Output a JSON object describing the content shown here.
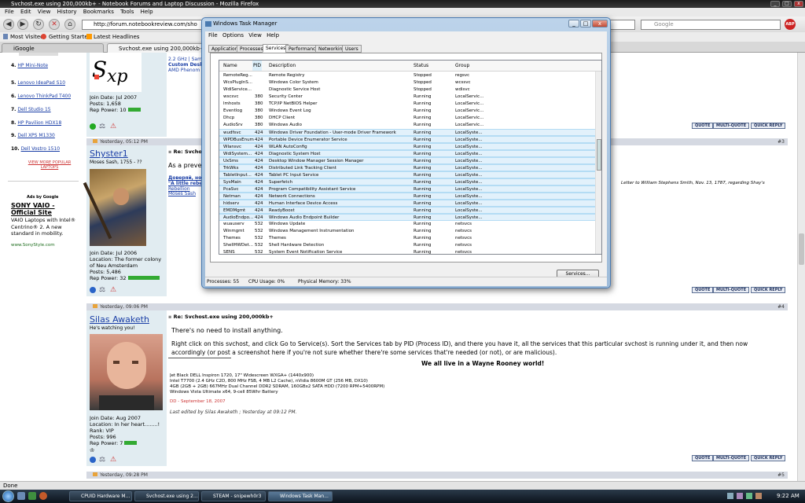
{
  "firefox": {
    "title": "Svchost.exe using 200,000kb+ - Notebook Forums and Laptop Discussion - Mozilla Firefox",
    "menu": [
      "File",
      "Edit",
      "View",
      "History",
      "Bookmarks",
      "Tools",
      "Help"
    ],
    "url": "http://forum.notebookreview.com/sho",
    "search_placeholder": "Google",
    "bookmarks": [
      "Most Visited",
      "Getting Started",
      "Latest Headlines"
    ],
    "tabs": [
      "iGoogle",
      "Svchost.exe using 200,000kb+ -..."
    ],
    "status": "Done"
  },
  "sidebar": {
    "items": [
      {
        "num": "4.",
        "label": "HP Mini-Note"
      },
      {
        "num": "5.",
        "label": "Lenovo IdeaPad S10"
      },
      {
        "num": "6.",
        "label": "Lenovo ThinkPad T400"
      },
      {
        "num": "7.",
        "label": "Dell Studio 15"
      },
      {
        "num": "8.",
        "label": "HP Pavilion HDX18"
      },
      {
        "num": "9.",
        "label": "Dell XPS M1330"
      },
      {
        "num": "10.",
        "label": "Dell Vostro 1510"
      }
    ],
    "view_more": "VIEW MORE POPULAR LAPTOPS",
    "ads_by": "Ads by Google",
    "ad_title": "SONY VAIO - Official Site",
    "ad_body": "VAIO Laptops with Intel® Centrino® 2. A new standard in mobility.",
    "ad_url": "www.SonyStyle.com"
  },
  "post_top": {
    "join": "Join Date: Jul 2007",
    "posts": "Posts: 1,658",
    "rep": "Rep Power: 10",
    "sig1": "2.2 GHz | Sam",
    "sig2": "Custom Deskt",
    "sig3": "AMD Phenom"
  },
  "post3": {
    "date": "Yesterday, 05:12 PM",
    "num": "#3",
    "user": "Shyster1",
    "subtitle": "Moses Sash, 1755 - ??",
    "title": "Re: Svchost",
    "text": "As a preven",
    "quote_tail": "Letter to William Stephens Smith, Nov. 13, 1787, regarding Shay's",
    "sig_a": "Доверяй, но п",
    "sig_b": "\"A little rebell",
    "sig_c": "Rebellion",
    "sig_d": "Moses Sash",
    "join": "Join Date: Jul 2006",
    "location": "Location: The former colony of Neu Amsterdam",
    "posts": "Posts: 5,486",
    "rep": "Rep Power: 32"
  },
  "post4": {
    "date": "Yesterday, 09:06 PM",
    "num": "#4",
    "user": "Silas Awaketh",
    "subtitle": "He's watching you!",
    "title": "Re: Svchost.exe using 200,000kb+",
    "line1": "There's no need to install anything.",
    "line2": "Right click on this svchost, and click Go to Service(s). Sort the Services tab by PID (Process ID), and there you have it, all the services that this particular svchost is running under it, and then now accordingly (or post a screenshot here if you're not sure whether there're some services that're needed (or not), or are malicious).",
    "sig_line": "We all live in a Wayne Rooney world!",
    "spec1": "Jet Black DELL Inspiron 1720, 17\" Widescreen WXGA+ (1440x900)",
    "spec2": "Intel T7700 (2.4 GHz C2D, 800 MHz FSB, 4 MB L2 Cache), nVidia 8600M GT (256 MB, DX10)",
    "spec3": "4GB (2GB + 2GB) 667MHz Dual Channel DDR2 SDRAM, 160GBx2 SATA HDD (7200 RPM+5400RPM)",
    "spec4": "Windows Vista Ultimate x64, 9-cell 85Whr Battery",
    "dd": "DD - September 18, 2007",
    "edited": "Last edited by Silas Awaketh ; Yesterday at 09:12 PM.",
    "join": "Join Date: Aug 2007",
    "location": "Location: In her heart........!",
    "rank": "Rank: VIP",
    "posts": "Posts: 996",
    "rep": "Rep Power: 7"
  },
  "post5": {
    "date": "Yesterday, 09:28 PM",
    "num": "#5"
  },
  "post_buttons": [
    "QUOTE",
    "MULTI-QUOTE",
    "QUICK REPLY"
  ],
  "task_manager": {
    "title": "Windows Task Manager",
    "menu": [
      "File",
      "Options",
      "View",
      "Help"
    ],
    "tabs": [
      "Applications",
      "Processes",
      "Services",
      "Performance",
      "Networking",
      "Users"
    ],
    "active_tab": "Services",
    "columns": [
      "Name",
      "PID",
      "Description",
      "Status",
      "Group"
    ],
    "rows": [
      {
        "name": "RemoteReg...",
        "pid": "",
        "desc": "Remote Registry",
        "status": "Stopped",
        "group": "regsvc",
        "sel": false
      },
      {
        "name": "WcsPlugInS...",
        "pid": "",
        "desc": "Windows Color System",
        "status": "Stopped",
        "group": "wcssvc",
        "sel": false
      },
      {
        "name": "WdiService...",
        "pid": "",
        "desc": "Diagnostic Service Host",
        "status": "Stopped",
        "group": "wdisvc",
        "sel": false
      },
      {
        "name": "wscsvc",
        "pid": "380",
        "desc": "Security Center",
        "status": "Running",
        "group": "LocalServic...",
        "sel": false
      },
      {
        "name": "lmhosts",
        "pid": "380",
        "desc": "TCP/IP NetBIOS Helper",
        "status": "Running",
        "group": "LocalServic...",
        "sel": false
      },
      {
        "name": "Eventlog",
        "pid": "380",
        "desc": "Windows Event Log",
        "status": "Running",
        "group": "LocalServic...",
        "sel": false
      },
      {
        "name": "Dhcp",
        "pid": "380",
        "desc": "DHCP Client",
        "status": "Running",
        "group": "LocalServic...",
        "sel": false
      },
      {
        "name": "AudioSrv",
        "pid": "380",
        "desc": "Windows Audio",
        "status": "Running",
        "group": "LocalServic...",
        "sel": false
      },
      {
        "name": "wudfsvc",
        "pid": "424",
        "desc": "Windows Driver Foundation - User-mode Driver Framework",
        "status": "Running",
        "group": "LocalSyste...",
        "sel": true
      },
      {
        "name": "WPDBusEnum",
        "pid": "424",
        "desc": "Portable Device Enumerator Service",
        "status": "Running",
        "group": "LocalSyste...",
        "sel": true
      },
      {
        "name": "Wlansvc",
        "pid": "424",
        "desc": "WLAN AutoConfig",
        "status": "Running",
        "group": "LocalSyste...",
        "sel": true
      },
      {
        "name": "WdiSystem...",
        "pid": "424",
        "desc": "Diagnostic System Host",
        "status": "Running",
        "group": "LocalSyste...",
        "sel": true
      },
      {
        "name": "UxSms",
        "pid": "424",
        "desc": "Desktop Window Manager Session Manager",
        "status": "Running",
        "group": "LocalSyste...",
        "sel": true
      },
      {
        "name": "TrkWks",
        "pid": "424",
        "desc": "Distributed Link Tracking Client",
        "status": "Running",
        "group": "LocalSyste...",
        "sel": true
      },
      {
        "name": "TabletInput...",
        "pid": "424",
        "desc": "Tablet PC Input Service",
        "status": "Running",
        "group": "LocalSyste...",
        "sel": true
      },
      {
        "name": "SysMain",
        "pid": "424",
        "desc": "Superfetch",
        "status": "Running",
        "group": "LocalSyste...",
        "sel": true
      },
      {
        "name": "PcaSvc",
        "pid": "424",
        "desc": "Program Compatibility Assistant Service",
        "status": "Running",
        "group": "LocalSyste...",
        "sel": true
      },
      {
        "name": "Netman",
        "pid": "424",
        "desc": "Network Connections",
        "status": "Running",
        "group": "LocalSyste...",
        "sel": true
      },
      {
        "name": "hidserv",
        "pid": "424",
        "desc": "Human Interface Device Access",
        "status": "Running",
        "group": "LocalSyste...",
        "sel": true
      },
      {
        "name": "EMDMgmt",
        "pid": "424",
        "desc": "ReadyBoost",
        "status": "Running",
        "group": "LocalSyste...",
        "sel": true
      },
      {
        "name": "AudioEndpo...",
        "pid": "424",
        "desc": "Windows Audio Endpoint Builder",
        "status": "Running",
        "group": "LocalSyste...",
        "sel": true
      },
      {
        "name": "wuauserv",
        "pid": "532",
        "desc": "Windows Update",
        "status": "Running",
        "group": "netsvcs",
        "sel": false
      },
      {
        "name": "Winmgmt",
        "pid": "532",
        "desc": "Windows Management Instrumentation",
        "status": "Running",
        "group": "netsvcs",
        "sel": false
      },
      {
        "name": "Themes",
        "pid": "532",
        "desc": "Themes",
        "status": "Running",
        "group": "netsvcs",
        "sel": false
      },
      {
        "name": "ShellHWDet...",
        "pid": "532",
        "desc": "Shell Hardware Detection",
        "status": "Running",
        "group": "netsvcs",
        "sel": false
      },
      {
        "name": "SENS",
        "pid": "532",
        "desc": "System Event Notification Service",
        "status": "Running",
        "group": "netsvcs",
        "sel": false
      }
    ],
    "services_button": "Services...",
    "processes": "Processes: 55",
    "cpu": "CPU Usage: 0%",
    "memory": "Physical Memory: 33%"
  },
  "taskbar": {
    "items": [
      "CPUID Hardware M...",
      "Svchost.exe using 2...",
      "STEAM - snipewh0r3",
      "Windows Task Man..."
    ],
    "clock": "9:22 AM"
  },
  "colors": {
    "link": "#1a3ea6",
    "post_header": "#d5d9e2",
    "userbox": "#e1ecf1",
    "selection": "#e2f1fb",
    "wayne": "#cc0000"
  }
}
